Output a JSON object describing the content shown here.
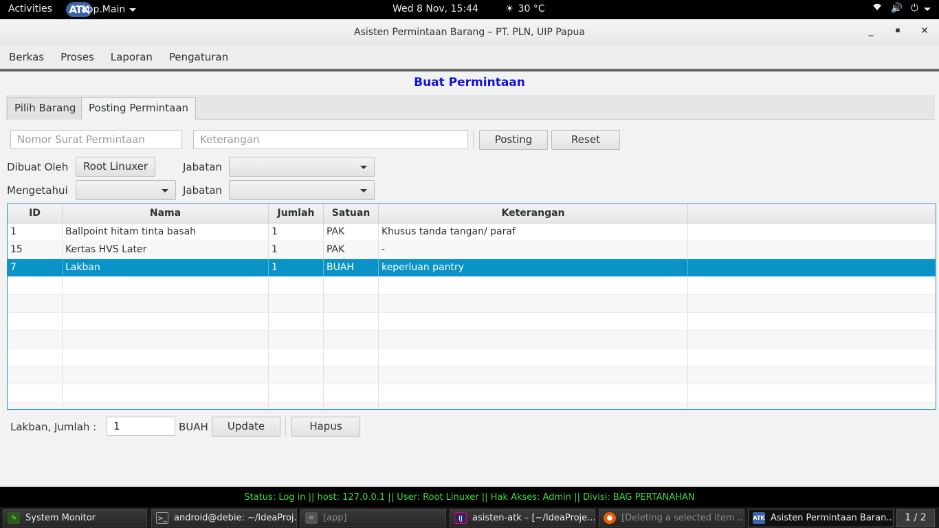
{
  "topbar": {
    "activities": "Activities",
    "app_menu_logo": "ATK",
    "app_menu": "app.Main",
    "clock": "Wed  8 Nov, 15:44",
    "weather": "30 °C"
  },
  "window": {
    "title": "Asisten Permintaan Barang – PT. PLN, UIP Papua",
    "menus": [
      "Berkas",
      "Proses",
      "Laporan",
      "Pengaturan"
    ]
  },
  "page": {
    "title": "Buat Permintaan",
    "tabs": [
      "Pilih Barang",
      "Posting Permintaan"
    ],
    "active_tab": "Posting Permintaan"
  },
  "form": {
    "nomor_surat_placeholder": "Nomor Surat Permintaan",
    "nomor_surat_value": "",
    "keterangan_placeholder": "Keterangan",
    "keterangan_value": "",
    "posting_label": "Posting",
    "reset_label": "Reset",
    "dibuat_oleh_label": "Dibuat Oleh",
    "dibuat_oleh_value": "Root Linuxer",
    "jabatan_label": "Jabatan",
    "jabatan1_value": "",
    "mengetahui_label": "Mengetahui",
    "mengetahui_value": "",
    "jabatan2_value": ""
  },
  "table": {
    "columns": [
      "ID",
      "Nama",
      "Jumlah",
      "Satuan",
      "Keterangan",
      ""
    ],
    "rows": [
      {
        "id": "1",
        "nama": "Ballpoint hitam tinta basah",
        "jumlah": "1",
        "satuan": "PAK",
        "keterangan": "Khusus tanda tangan/ paraf"
      },
      {
        "id": "15",
        "nama": "Kertas HVS Later",
        "jumlah": "1",
        "satuan": "PAK",
        "keterangan": "-"
      },
      {
        "id": "7",
        "nama": "Lakban",
        "jumlah": "1",
        "satuan": "BUAH",
        "keterangan": "keperluan pantry"
      }
    ],
    "selected_row": 2
  },
  "edit": {
    "item_label": "Lakban,  Jumlah :",
    "jumlah_value": "1",
    "satuan": "BUAH",
    "update_label": "Update",
    "hapus_label": "Hapus"
  },
  "status": "Status: Log in  ||  host: 127.0.0.1  ||  User: Root Linuxer  ||  Hak Akses: Admin  ||  Divisi: BAG PERTANAHAN",
  "taskbar": {
    "tasks": [
      "System Monitor",
      "android@debie: ~/IdeaProj...",
      "[app]",
      "asisten-atk – [~/IdeaProje...",
      "[Deleting a selected item ...",
      "Asisten Permintaan Baran..."
    ],
    "pager": "1 / 2"
  },
  "colors": {
    "title_blue": "#1010d8",
    "selection": "#0a93c6",
    "status_green": "#3ddc3d"
  }
}
